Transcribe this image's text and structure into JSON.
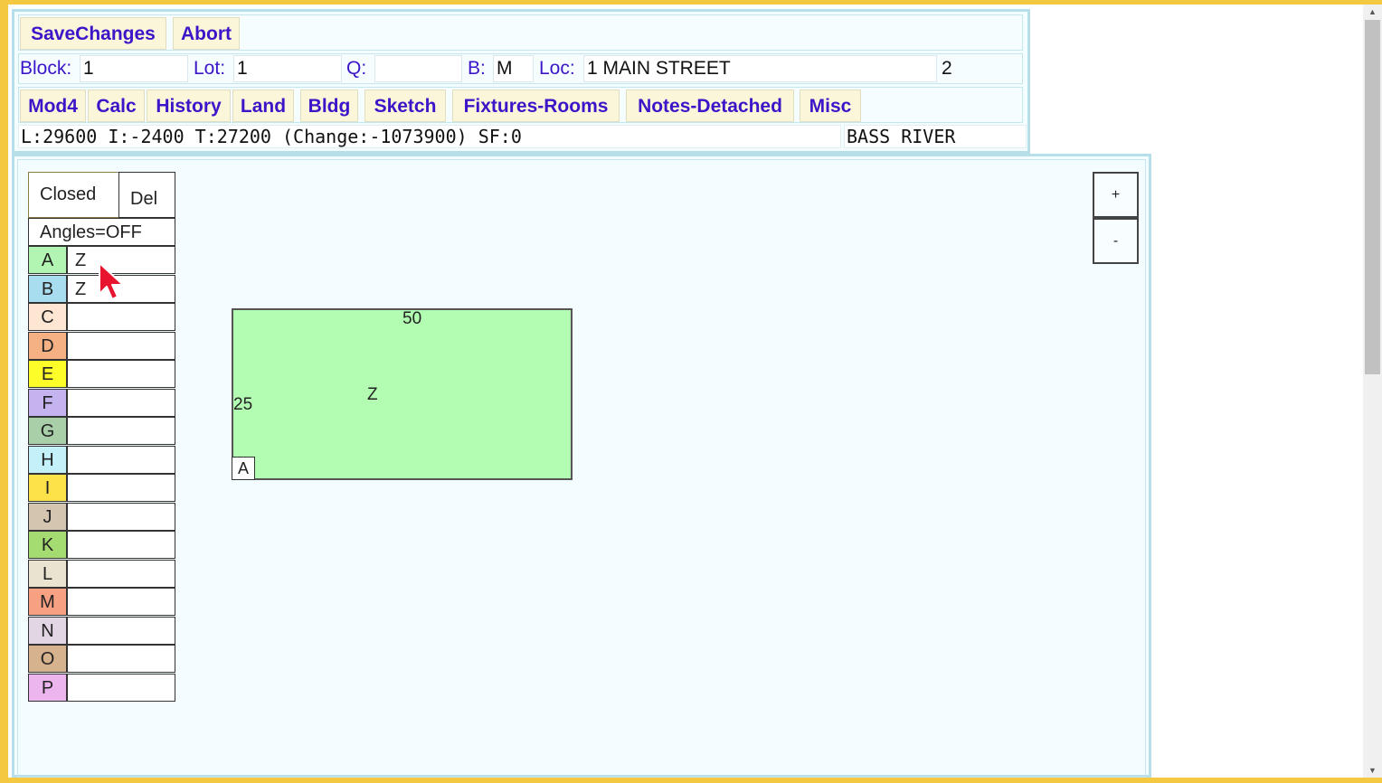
{
  "toolbar": {
    "save_label": "SaveChanges",
    "abort_label": "Abort"
  },
  "record": {
    "block_label": "Block:",
    "block_value": "1",
    "lot_label": "Lot:",
    "lot_value": "1",
    "q_label": "Q:",
    "q_value": "",
    "b_label": "B:",
    "b_value": "M",
    "loc_label": "Loc:",
    "loc_value": "1 MAIN STREET",
    "card_number": "2"
  },
  "nav_tabs": [
    {
      "label": "Mod4"
    },
    {
      "label": "Calc"
    },
    {
      "label": "History"
    },
    {
      "label": "Land"
    },
    {
      "label": "Bldg"
    },
    {
      "label": "Sketch"
    },
    {
      "label": "Fixtures-Rooms"
    },
    {
      "label": "Notes-Detached"
    },
    {
      "label": "Misc"
    }
  ],
  "summary": {
    "values_text": "L:29600 I:-2400 T:27200 (Change:-1073900) SF:0",
    "town": "BASS RIVER"
  },
  "sketch_panel": {
    "closed_label": "Closed",
    "del_label": "Del",
    "angles_label": "Angles=OFF",
    "areas": [
      {
        "letter": "A",
        "code": "Z",
        "color": "#b2f5b2"
      },
      {
        "letter": "B",
        "code": "Z",
        "color": "#a8dcef"
      },
      {
        "letter": "C",
        "code": "",
        "color": "#fde7d3"
      },
      {
        "letter": "D",
        "code": "",
        "color": "#f5b184"
      },
      {
        "letter": "E",
        "code": "",
        "color": "#fdfd2a"
      },
      {
        "letter": "F",
        "code": "",
        "color": "#c5b3ef"
      },
      {
        "letter": "G",
        "code": "",
        "color": "#a9cfa9"
      },
      {
        "letter": "H",
        "code": "",
        "color": "#c4f1f9"
      },
      {
        "letter": "I",
        "code": "",
        "color": "#fde24a"
      },
      {
        "letter": "J",
        "code": "",
        "color": "#d3c5b0"
      },
      {
        "letter": "K",
        "code": "",
        "color": "#a5dc72"
      },
      {
        "letter": "L",
        "code": "",
        "color": "#e9e3cf"
      },
      {
        "letter": "M",
        "code": "",
        "color": "#f8a182"
      },
      {
        "letter": "N",
        "code": "",
        "color": "#e2d5e4"
      },
      {
        "letter": "O",
        "code": "",
        "color": "#d6b28f"
      },
      {
        "letter": "P",
        "code": "",
        "color": "#edb5ed"
      }
    ],
    "zoom_in_label": "+",
    "zoom_out_label": "-"
  },
  "drawing": {
    "width_label": "50",
    "height_label": "25",
    "area_code": "Z",
    "area_letter": "A",
    "fill_color": "#b2fdb2"
  }
}
